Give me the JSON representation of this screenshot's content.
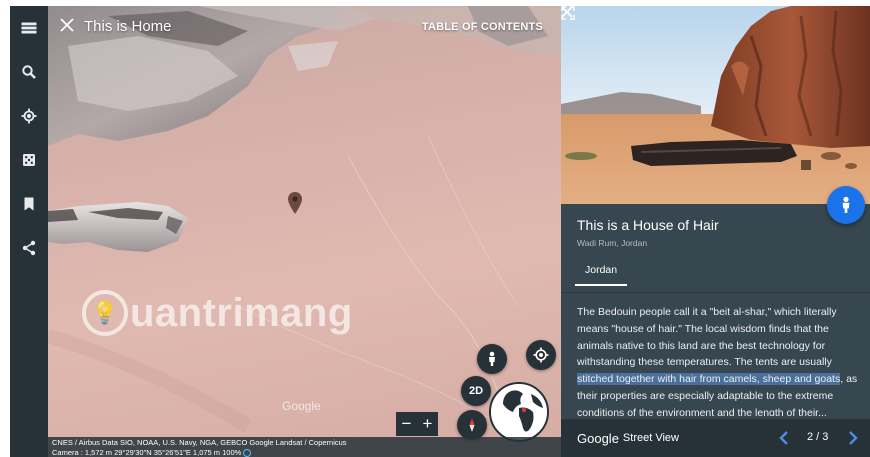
{
  "map": {
    "title": "This is Home",
    "toc_label": "TABLE OF CONTENTS",
    "watermark": "uantrimang",
    "watermark_letter": "Q",
    "google_logo": "Google",
    "btn_2d": "2D",
    "zoom_minus": "−",
    "zoom_plus": "+",
    "attribution_line1": "CNES / Airbus  Data SIO, NOAA, U.S. Navy, NGA, GEBCO  Google  Landsat / Copernicus",
    "attribution_line2": "Camera : 1,572 m   29°29'30\"N 35°26'51\"E   1,075 m   100%"
  },
  "rail": {
    "icons": [
      "menu-icon",
      "search-icon",
      "voyager-icon",
      "dice-icon",
      "bookmark-icon",
      "share-icon"
    ]
  },
  "panel": {
    "title": "This is a House of Hair",
    "subtitle": "Wadi Rum, Jordan",
    "tab": "Jordan",
    "text_before": "The Bedouin people call it a \"beit al-shar,\" which literally means \"house of hair.\" The local wisdom finds that the animals native to this land are the best technology for withstanding these temperatures. The tents are usually ",
    "text_highlight": "stitched together with hair from camels, sheep and goats",
    "text_after": ", as their properties are especially adaptable to the extreme conditions of the environment and the length of their...",
    "footer_google": "Google",
    "footer_sv": "Street View",
    "page_count": "2 / 3"
  },
  "colors": {
    "rail": "#263238",
    "panel": "#37474f",
    "accent": "#1a73e8",
    "highlight": "#4a6f9a"
  }
}
